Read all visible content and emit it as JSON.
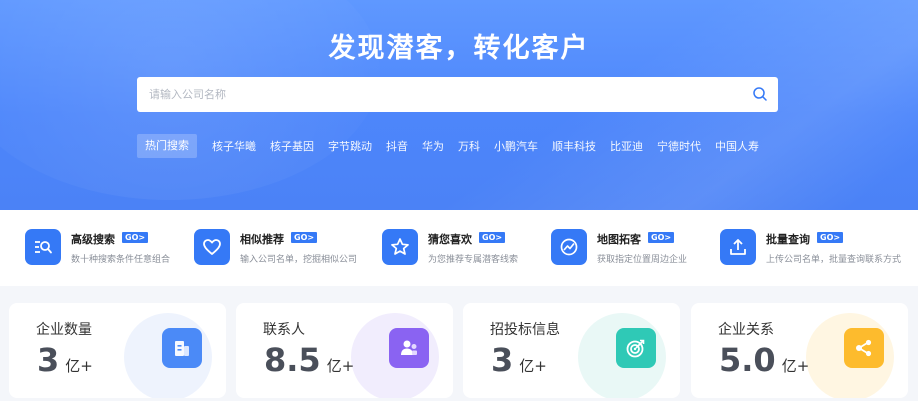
{
  "hero": {
    "title": "发现潜客，转化客户"
  },
  "search": {
    "placeholder": "请输入公司名称",
    "icon": "search-icon"
  },
  "hot_search": {
    "label": "热门搜索",
    "items": [
      "核子华曦",
      "核子基因",
      "字节跳动",
      "抖音",
      "华为",
      "万科",
      "小鹏汽车",
      "顺丰科技",
      "比亚迪",
      "宁德时代",
      "中国人寿"
    ]
  },
  "features": [
    {
      "title": "高级搜索",
      "go": "GO>",
      "desc": "数十种搜索条件任意组合",
      "icon": "advanced-search-icon"
    },
    {
      "title": "相似推荐",
      "go": "GO>",
      "desc": "输入公司名单，挖掘相似公司",
      "icon": "heart-icon"
    },
    {
      "title": "猜您喜欢",
      "go": "GO>",
      "desc": "为您推荐专属潜客线索",
      "icon": "star-icon"
    },
    {
      "title": "地图拓客",
      "go": "GO>",
      "desc": "获取指定位置周边企业",
      "icon": "map-icon"
    },
    {
      "title": "批量查询",
      "go": "GO>",
      "desc": "上传公司名单，批量查询联系方式",
      "icon": "upload-icon"
    }
  ],
  "stats": [
    {
      "label": "企业数量",
      "value": "3",
      "unit": "亿+",
      "icon": "building-icon",
      "color": "#4b8af7"
    },
    {
      "label": "联系人",
      "value": "8.5",
      "unit": "亿+",
      "icon": "contacts-icon",
      "color": "#8a63f2"
    },
    {
      "label": "招投标信息",
      "value": "3",
      "unit": "亿+",
      "icon": "target-icon",
      "color": "#2fc9b6"
    },
    {
      "label": "企业关系",
      "value": "5.0",
      "unit": "亿+",
      "icon": "share-icon",
      "color": "#fdbb2d"
    }
  ],
  "colors": {
    "accent": "#3579f6",
    "hero": "#4d86fb"
  }
}
